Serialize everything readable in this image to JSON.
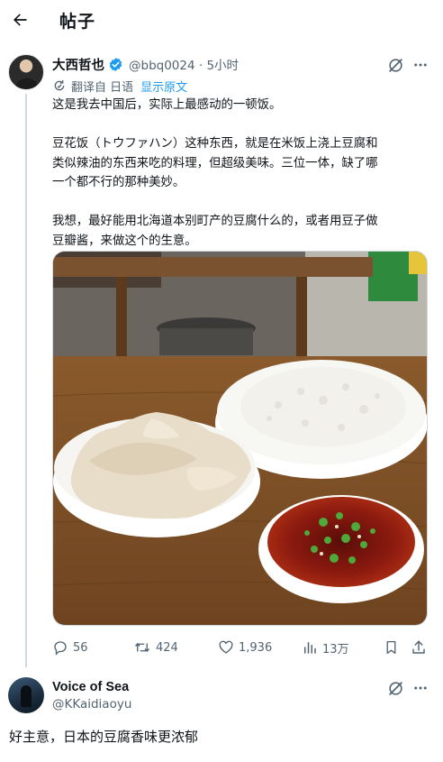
{
  "header": {
    "title": "帖子",
    "back_icon": "arrow-left-icon"
  },
  "post": {
    "author": {
      "display_name": "大西哲也",
      "handle_time": "@bbq0024 · 5小时",
      "verified": true
    },
    "translation": {
      "label": "翻译自 日语",
      "show_original": "显示原文"
    },
    "paragraphs": [
      [
        "这是我去中国后，实际上最感动的一顿饭。"
      ],
      [
        "豆花饭（トウファハン）这种东西，就是在米饭上浇上豆腐和",
        "类似辣油的东西来吃的料理，但超级美味。三位一体，缺了哪",
        "一个都不行的那种美妙。"
      ],
      [
        "我想，最好能用北海道本别町产的豆腐什么的，或者用豆子做",
        "豆瓣酱，来做这个的生意。"
      ]
    ],
    "media": {
      "icon": "photo-douhua-rice"
    },
    "stats": {
      "replies": "56",
      "reposts": "424",
      "likes": "1,936",
      "views": "13万"
    }
  },
  "reply": {
    "author": {
      "display_name": "Voice of Sea",
      "handle": "@KKaidiaoyu"
    },
    "text": "好主意，日本的豆腐香味更浓郁"
  },
  "colors": {
    "accent": "#1d9bf0",
    "text_primary": "#0f1419",
    "text_secondary": "#536471",
    "divider": "#cfd9de"
  }
}
